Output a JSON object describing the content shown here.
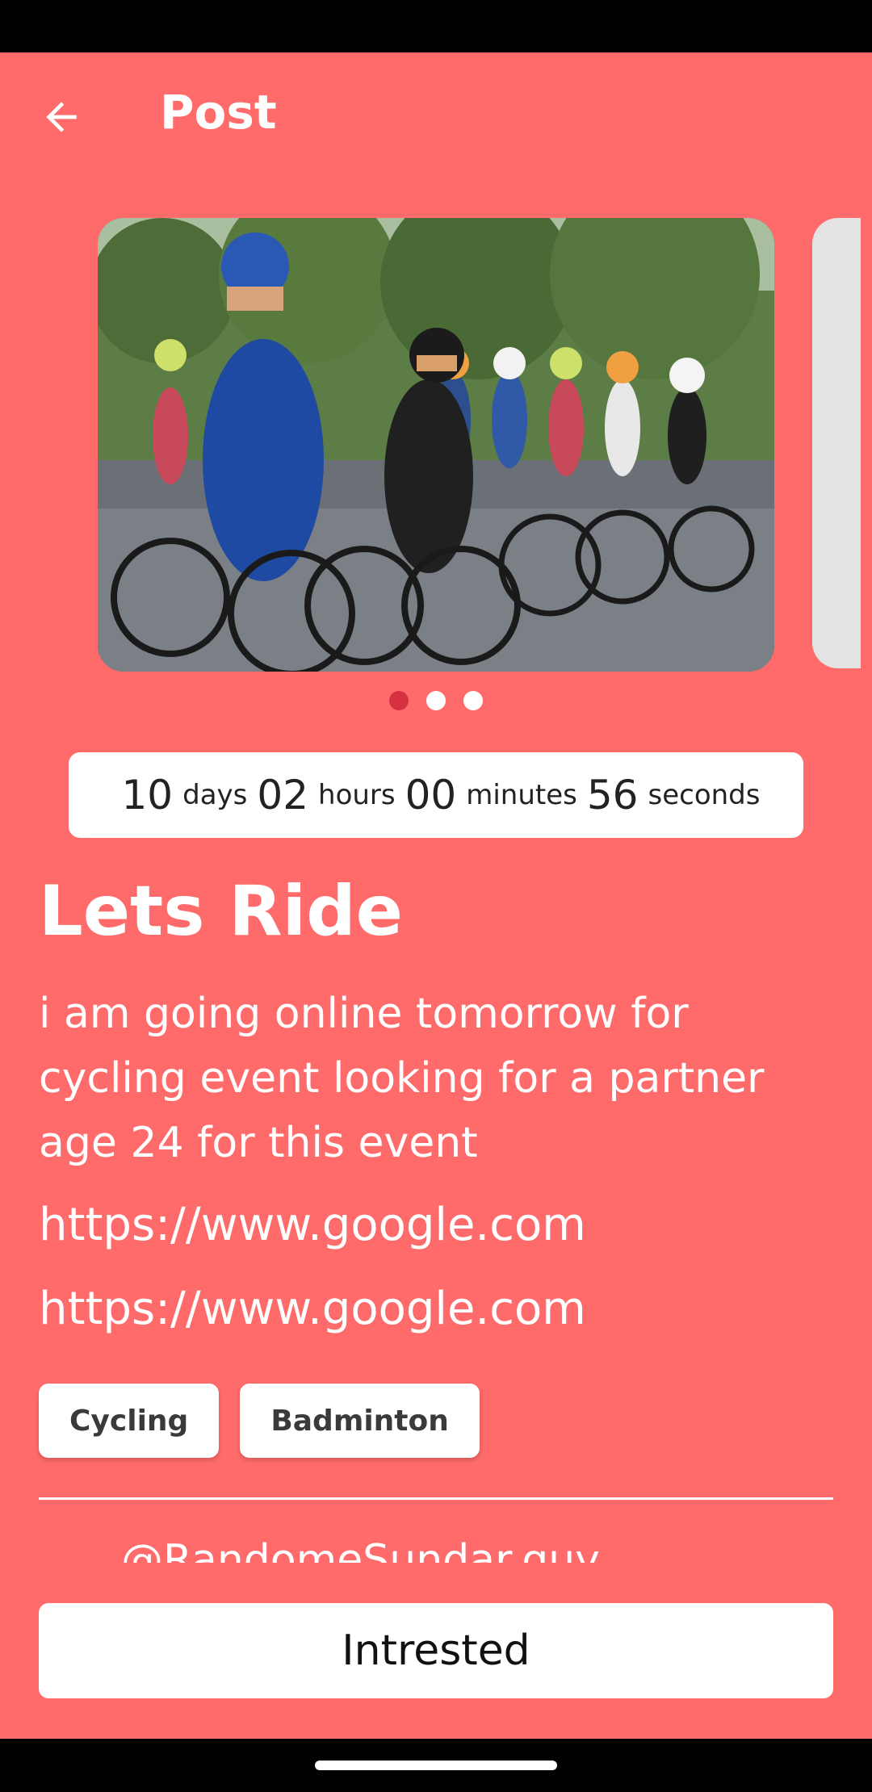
{
  "header": {
    "title": "Post"
  },
  "carousel": {
    "image_alt": "Group of road cyclists racing",
    "page_count": 3,
    "active_index": 0
  },
  "countdown": {
    "days": "10",
    "days_label": "days",
    "hours": "02",
    "hours_label": "hours",
    "minutes": "00",
    "minutes_label": "minutes",
    "seconds": "56",
    "seconds_label": "seconds"
  },
  "post": {
    "title": "Lets Ride",
    "description": "i am going online tomorrow for cycling event looking for a partner age 24 for this event",
    "links": [
      "https://www.google.com",
      "https://www.google.com"
    ],
    "tags": [
      "Cycling",
      "Badminton"
    ],
    "author_handle": "@RandomeSundar.guy"
  },
  "cta": {
    "label": "Intrested"
  },
  "colors": {
    "background": "#FF6B6B",
    "active_dot": "#D63140",
    "surface": "#FFFFFF"
  },
  "icons": {
    "back": "arrow-left-icon"
  }
}
